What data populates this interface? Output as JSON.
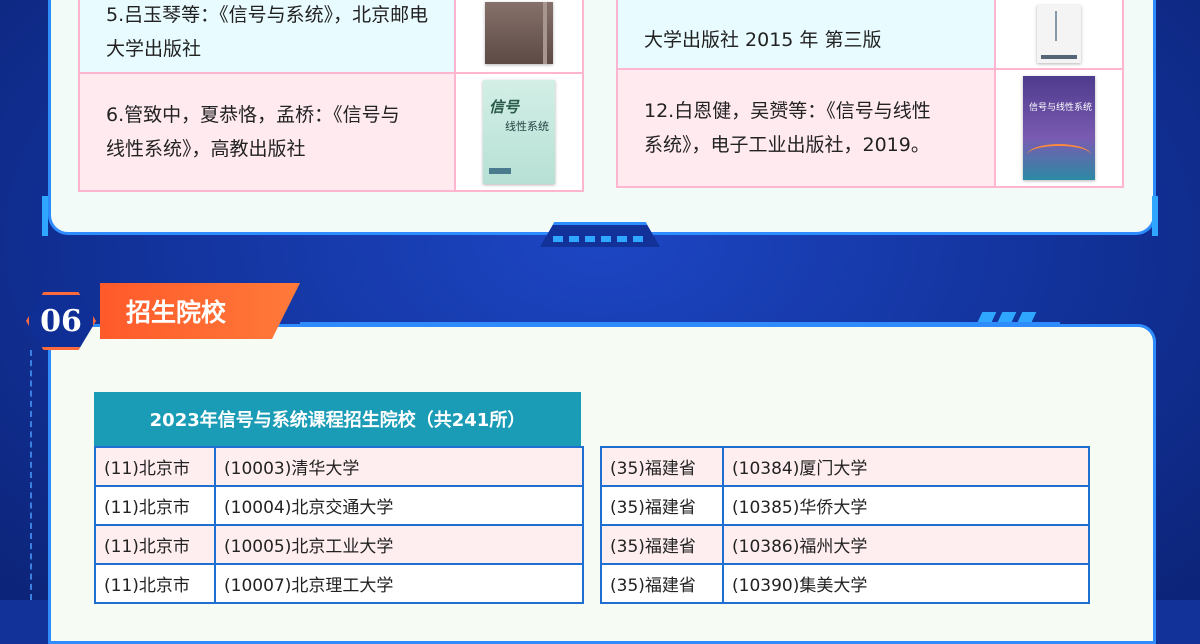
{
  "books_left": [
    {
      "text_lines": [
        "5.吕玉琴等：《信号与系统》，北京邮电",
        "大学出版社"
      ],
      "cover": "dark-book-cover"
    },
    {
      "text_lines": [
        "6.管致中，夏恭恪，孟桥：《信号与",
        "线性系统》，高教出版社"
      ],
      "cover": "green-book-cover",
      "cover_title": "信号",
      "cover_subtitle": "线性系统"
    }
  ],
  "books_right": [
    {
      "text_lines": [
        "大学出版社 2015 年 第三版"
      ],
      "cover": "white-book-cover"
    },
    {
      "text_lines": [
        "12.白恩健，吴赟等：《信号与线性",
        "系统》，电子工业出版社，2019。"
      ],
      "cover": "purple-book-cover",
      "cover_title": "信号与线性系统"
    }
  ],
  "section": {
    "number": "06",
    "title": "招生院校"
  },
  "list_title": "2023年信号与系统课程招生院校（共241所）",
  "left_schools": [
    {
      "region": "(11)北京市",
      "school": "(10003)清华大学"
    },
    {
      "region": "(11)北京市",
      "school": "(10004)北京交通大学"
    },
    {
      "region": "(11)北京市",
      "school": "(10005)北京工业大学"
    },
    {
      "region": "(11)北京市",
      "school": "(10007)北京理工大学"
    }
  ],
  "right_schools": [
    {
      "region": "(35)福建省",
      "school": "(10384)厦门大学"
    },
    {
      "region": "(35)福建省",
      "school": "(10385)华侨大学"
    },
    {
      "region": "(35)福建省",
      "school": "(10386)福州大学"
    },
    {
      "region": "(35)福建省",
      "school": "(10390)集美大学"
    }
  ]
}
